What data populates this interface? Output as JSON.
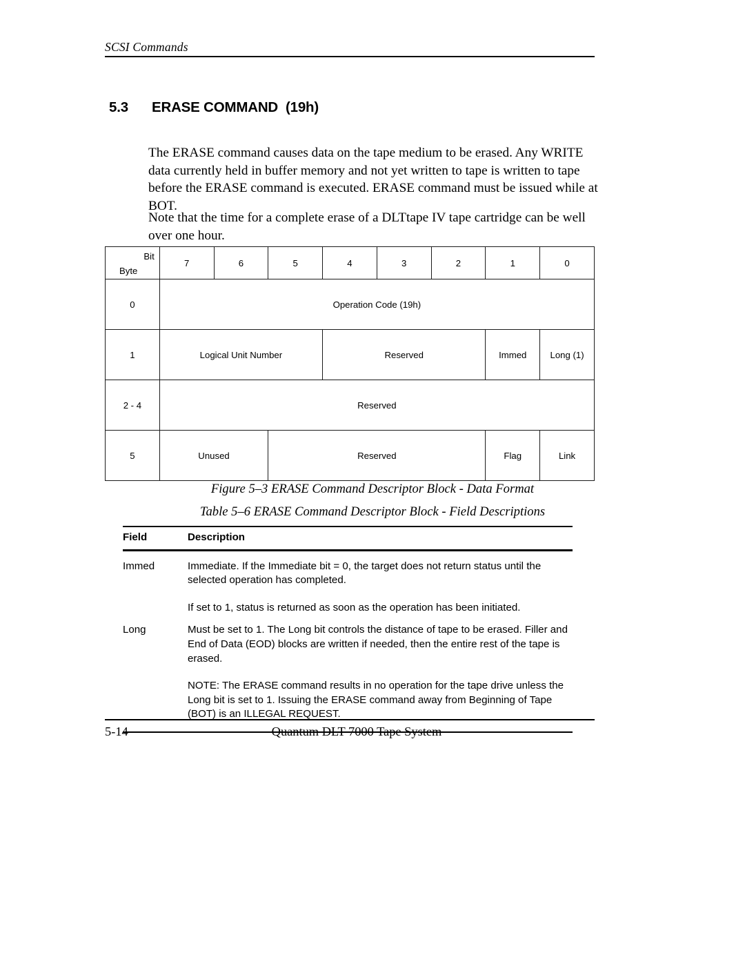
{
  "header": {
    "running_title": "SCSI Commands"
  },
  "section": {
    "number": "5.3",
    "title": "ERASE COMMAND  (19h)"
  },
  "body": {
    "paragraph_1": "The ERASE command causes data on the tape medium to be erased. Any WRITE data currently held in buffer memory and not yet written to tape is written to tape before the ERASE command is executed. ERASE command must be issued while at BOT.",
    "paragraph_2": "Note that the time for a complete erase of a DLTtape IV tape cartridge can be well over one hour."
  },
  "cdb_table": {
    "corner_bit_label": "Bit",
    "corner_byte_label": "Byte",
    "bit_headers": [
      "7",
      "6",
      "5",
      "4",
      "3",
      "2",
      "1",
      "0"
    ],
    "rows": [
      {
        "byte": "0",
        "cells": [
          {
            "label": "Operation Code (19h)",
            "span": 8
          }
        ]
      },
      {
        "byte": "1",
        "cells": [
          {
            "label": "Logical Unit Number",
            "span": 3
          },
          {
            "label": "Reserved",
            "span": 3
          },
          {
            "label": "Immed",
            "span": 1
          },
          {
            "label": "Long (1)",
            "span": 1
          }
        ]
      },
      {
        "byte": "2 - 4",
        "cells": [
          {
            "label": "Reserved",
            "span": 8
          }
        ]
      },
      {
        "byte": "5",
        "cells": [
          {
            "label": "Unused",
            "span": 2
          },
          {
            "label": "Reserved",
            "span": 4
          },
          {
            "label": "Flag",
            "span": 1
          },
          {
            "label": "Link",
            "span": 1
          }
        ]
      }
    ]
  },
  "captions": {
    "figure": "Figure 5–3  ERASE Command Descriptor Block - Data Format",
    "table": "Table 5–6  ERASE Command Descriptor Block - Field Descriptions"
  },
  "field_table": {
    "headers": {
      "field": "Field",
      "description": "Description"
    },
    "rows": [
      {
        "field": "Immed",
        "paragraphs": [
          "Immediate. If the Immediate bit = 0, the target does not return status until the selected operation has completed.",
          "If set to 1, status is returned as soon as the operation has been initiated."
        ]
      },
      {
        "field": "Long",
        "paragraphs": [
          "Must be set to 1. The Long bit controls the distance of tape to be erased. Filler and End of Data (EOD) blocks are written if needed, then the entire rest of the tape is erased.",
          "NOTE:  The ERASE command results in no operation for the tape drive unless the Long bit is set to 1. Issuing the ERASE command away from Beginning of Tape (BOT) is an ILLEGAL REQUEST."
        ]
      }
    ]
  },
  "footer": {
    "page_number": "5-14",
    "document_title": "Quantum DLT 7000 Tape System"
  }
}
